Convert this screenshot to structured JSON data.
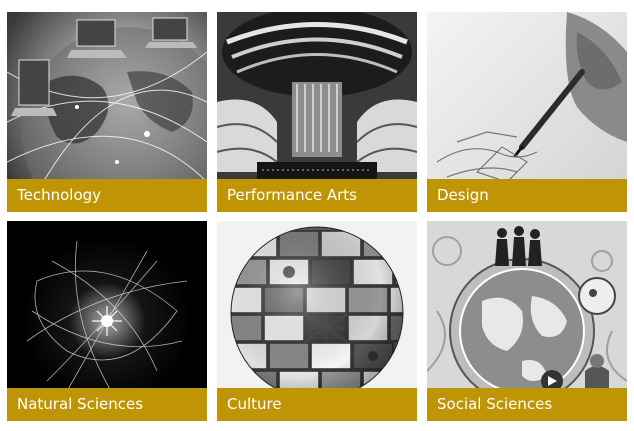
{
  "colors": {
    "caption_bar": "#bf9505"
  },
  "tiles": [
    {
      "label": "Technology",
      "icon": "globe-laptops-icon"
    },
    {
      "label": "Performance Arts",
      "icon": "concert-hall-icon"
    },
    {
      "label": "Design",
      "icon": "hand-sketching-icon"
    },
    {
      "label": "Natural Sciences",
      "icon": "light-burst-icon"
    },
    {
      "label": "Culture",
      "icon": "flag-sphere-icon"
    },
    {
      "label": "Social Sciences",
      "icon": "people-on-globe-icon"
    }
  ]
}
